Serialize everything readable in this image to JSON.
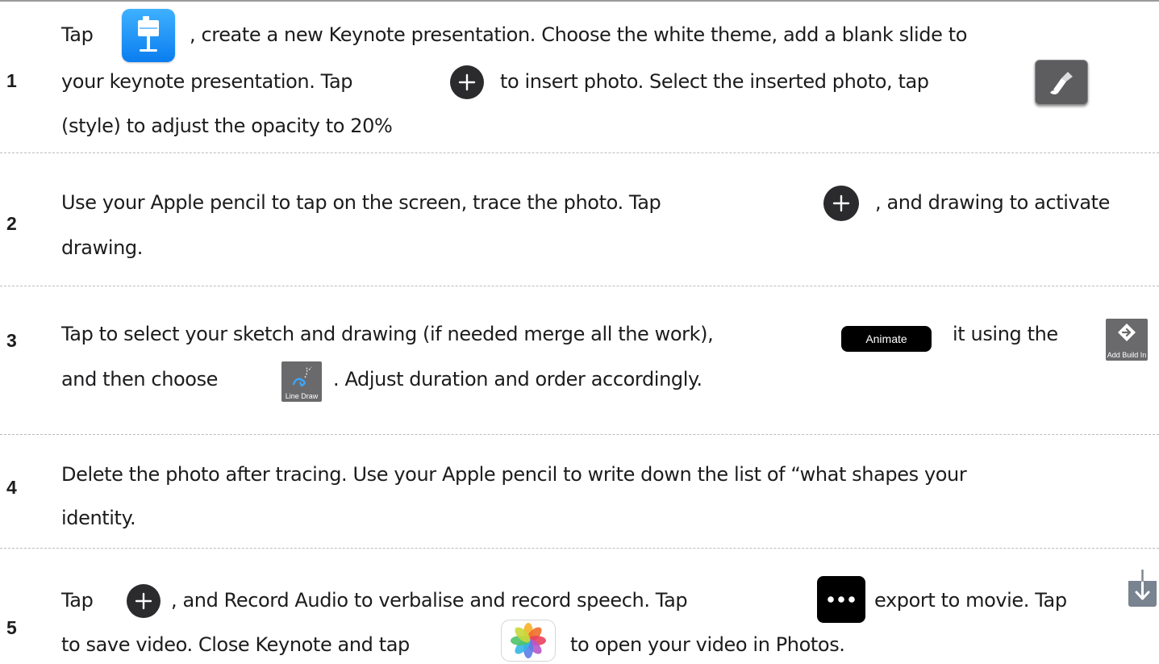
{
  "steps": [
    {
      "number": "1",
      "lines": [
        {
          "t1": "Tap",
          "t2": ", create a new Keynote presentation. Choose the white theme, add a blank slide to"
        },
        {
          "t1": "your keynote presentation. Tap",
          "t2": "to insert photo. Select the inserted photo, tap"
        },
        {
          "t1": "(style) to adjust the opacity to 20%"
        }
      ]
    },
    {
      "number": "2",
      "lines": [
        {
          "t1": "Use your Apple pencil to tap on the screen, trace the photo.  Tap",
          "t2": ", and drawing to activate"
        },
        {
          "t1": "drawing."
        }
      ]
    },
    {
      "number": "3",
      "lines": [
        {
          "t1": "Tap to select your sketch and drawing (if needed merge all the work),",
          "t2": "it using the"
        },
        {
          "t1": "and then choose",
          "t2": ". Adjust duration and order accordingly."
        }
      ],
      "animate_label": "Animate",
      "build_label": "Add Build In",
      "linedraw_label": "Line Draw"
    },
    {
      "number": "4",
      "lines": [
        {
          "t1": "Delete the photo after tracing. Use your Apple pencil to write down the list of “what shapes your"
        },
        {
          "t1": "identity."
        }
      ]
    },
    {
      "number": "5",
      "lines": [
        {
          "t1": "Tap",
          "t2": ", and Record Audio to verbalise and record speech. Tap",
          "t3": "export to movie. Tap"
        },
        {
          "t1": "to save video. Close Keynote and tap",
          "t2": "to open your video in Photos."
        }
      ]
    }
  ],
  "icons": {
    "keynote": "keynote-app-icon",
    "add": "plus-circle-icon",
    "style": "paintbrush-icon",
    "add_build_in": "diamond-arrow-icon",
    "line_draw": "line-draw-icon",
    "more": "ellipsis-icon",
    "save": "download-arrow-icon",
    "photos": "photos-app-icon"
  },
  "colors": {
    "text": "#1c1c1e",
    "keynote_blue": "#0a7df0",
    "button_dark": "#2b2b2d",
    "divider": "#bdbdbd"
  }
}
